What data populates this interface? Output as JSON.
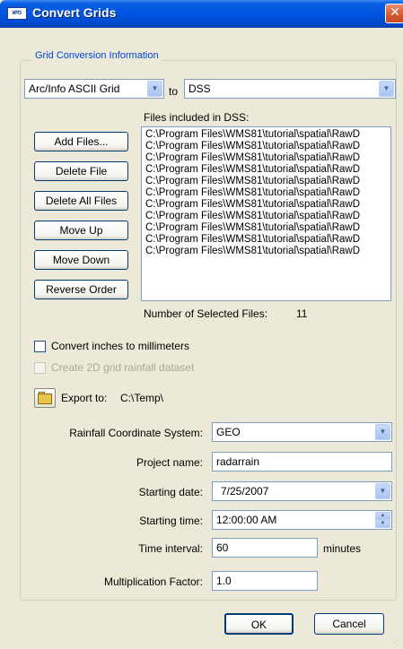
{
  "window": {
    "title": "Convert Grids",
    "app_icon_text": "WMS",
    "close_glyph": "✕"
  },
  "group": {
    "caption": "Grid Conversion Information"
  },
  "conversion": {
    "from_format": "Arc/Info ASCII Grid",
    "to_label": "to",
    "to_format": "DSS"
  },
  "files": {
    "label": "Files included in DSS:",
    "items": [
      "C:\\Program Files\\WMS81\\tutorial\\spatial\\RawD",
      "C:\\Program Files\\WMS81\\tutorial\\spatial\\RawD",
      "C:\\Program Files\\WMS81\\tutorial\\spatial\\RawD",
      "C:\\Program Files\\WMS81\\tutorial\\spatial\\RawD",
      "C:\\Program Files\\WMS81\\tutorial\\spatial\\RawD",
      "C:\\Program Files\\WMS81\\tutorial\\spatial\\RawD",
      "C:\\Program Files\\WMS81\\tutorial\\spatial\\RawD",
      "C:\\Program Files\\WMS81\\tutorial\\spatial\\RawD",
      "C:\\Program Files\\WMS81\\tutorial\\spatial\\RawD",
      "C:\\Program Files\\WMS81\\tutorial\\spatial\\RawD",
      "C:\\Program Files\\WMS81\\tutorial\\spatial\\RawD"
    ],
    "count_label": "Number of Selected Files:",
    "count_value": "11"
  },
  "buttons": {
    "add_files": "Add Files...",
    "delete_file": "Delete File",
    "delete_all": "Delete All Files",
    "move_up": "Move Up",
    "move_down": "Move Down",
    "reverse_order": "Reverse Order",
    "ok": "OK",
    "cancel": "Cancel"
  },
  "options": {
    "convert_inches": {
      "label": "Convert inches to millimeters",
      "checked": false,
      "enabled": true
    },
    "create_2d": {
      "label": "Create 2D grid rainfall dataset",
      "checked": false,
      "enabled": false
    }
  },
  "export": {
    "label": "Export to:",
    "path": "C:\\Temp\\"
  },
  "form": {
    "coord_system_label": "Rainfall Coordinate System:",
    "coord_system_value": "GEO",
    "project_name_label": "Project name:",
    "project_name_value": "radarrain",
    "start_date_label": "Starting date:",
    "start_date_value": "7/25/2007",
    "start_time_label": "Starting time:",
    "start_time_value": "12:00:00 AM",
    "interval_label": "Time interval:",
    "interval_value": "60",
    "interval_units": "minutes",
    "mult_label": "Multiplication Factor:",
    "mult_value": "1.0"
  },
  "icons": {
    "dropdown": "chevron-down-icon",
    "spin_up": "spin-up-icon",
    "spin_down": "spin-down-icon",
    "folder": "folder-open-icon"
  },
  "colors": {
    "titlebar": "#0054e3",
    "group_caption": "#0046d5",
    "close": "#d55a32",
    "dialog_bg": "#ece9d8"
  }
}
